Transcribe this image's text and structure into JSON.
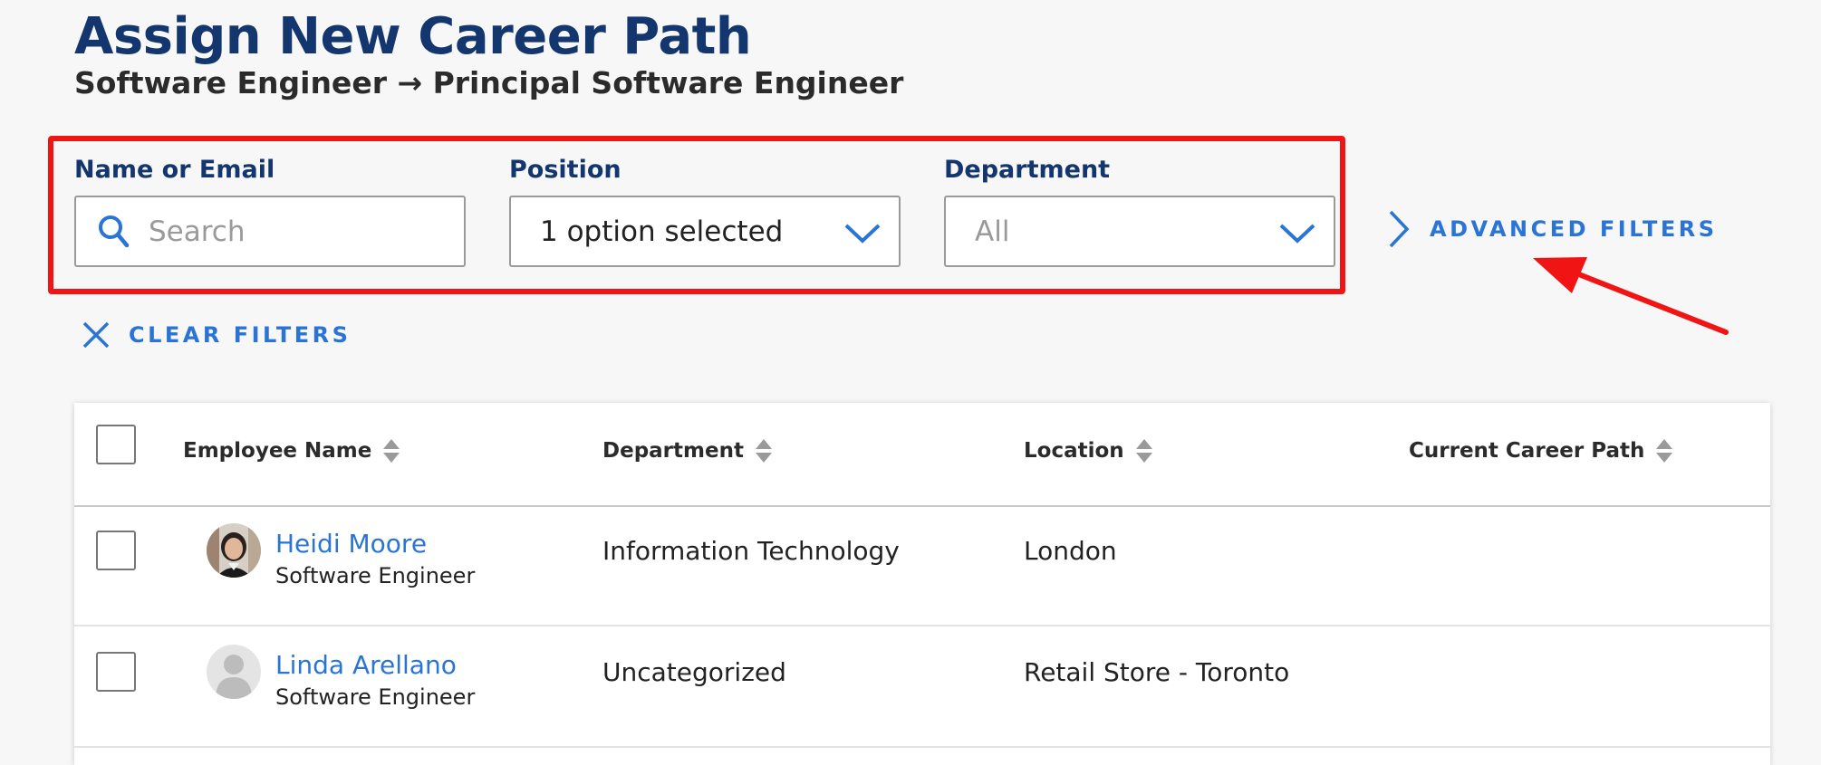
{
  "header": {
    "title": "Assign New Career Path",
    "subtitle": "Software Engineer → Principal Software Engineer"
  },
  "filters": {
    "name_or_email": {
      "label": "Name or Email",
      "placeholder": "Search",
      "value": "",
      "icon": "search-icon"
    },
    "position": {
      "label": "Position",
      "value": "1 option selected",
      "icon": "chevron-down-icon"
    },
    "department": {
      "label": "Department",
      "value": "All",
      "icon": "chevron-down-icon"
    },
    "advanced_filters_label": "ADVANCED FILTERS",
    "clear_filters_label": "CLEAR FILTERS"
  },
  "table": {
    "columns": [
      "Employee Name",
      "Department",
      "Location",
      "Current Career Path"
    ],
    "rows": [
      {
        "name": "Heidi Moore",
        "title": "Software Engineer",
        "department": "Information Technology",
        "location": "London",
        "career_path": "",
        "avatar": "photo"
      },
      {
        "name": "Linda Arellano",
        "title": "Software Engineer",
        "department": "Uncategorized",
        "location": "Retail Store - Toronto",
        "career_path": "",
        "avatar": "placeholder"
      }
    ]
  },
  "colors": {
    "title": "#14366f",
    "accent": "#2a74d6",
    "annotation": "#f01414",
    "background": "#f7f7f7"
  }
}
